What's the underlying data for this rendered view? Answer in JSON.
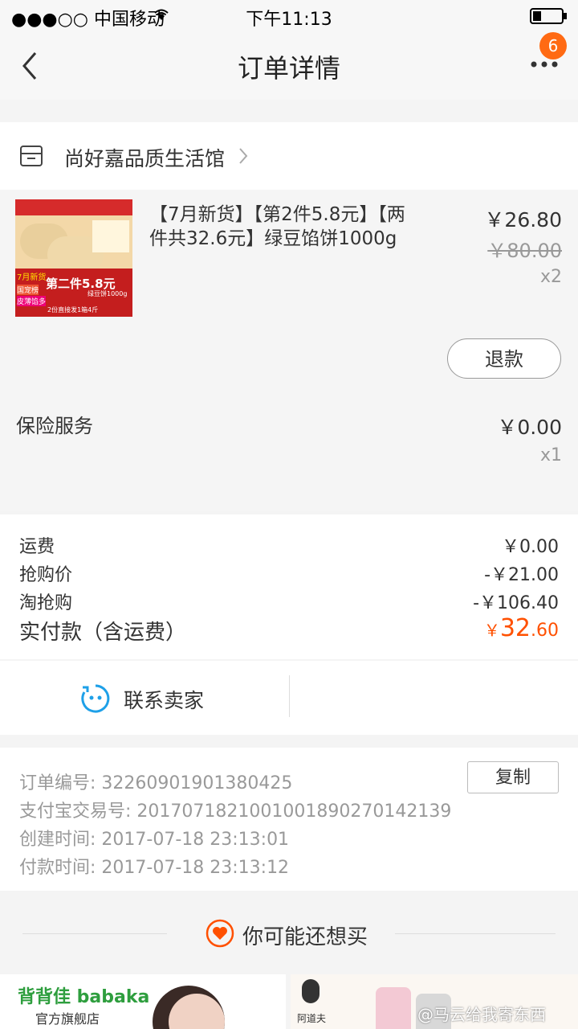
{
  "status_bar": {
    "carrier": "●●●○○ 中国移动",
    "time": "下午11:13"
  },
  "nav": {
    "title": "订单详情",
    "badge_count": "6"
  },
  "shop": {
    "name": "尚好嘉品质生活馆"
  },
  "product": {
    "title_line1": "【7月新货】【第2件5.8元】【两",
    "title_line2": "件共32.6元】绿豆馅饼1000g",
    "price": "￥26.80",
    "original_price": "￥80.00",
    "quantity": "x2",
    "image": {
      "banner_top": "7月新货",
      "banner_main": "第二件5.8元",
      "tag_left_1": "国宠榜",
      "tag_left_2": "皮薄馅多",
      "tag_right": "绿豆饼1000g",
      "footer": "2份直接发1箱4斤"
    },
    "refund_label": "退款"
  },
  "insurance": {
    "label": "保险服务",
    "price": "￥0.00",
    "quantity": "x1"
  },
  "charges": [
    {
      "label": "运费",
      "value": "￥0.00"
    },
    {
      "label": "抢购价",
      "value": "-￥21.00"
    },
    {
      "label": "淘抢购",
      "value": "-￥106.40"
    }
  ],
  "total": {
    "label": "实付款（含运费）",
    "currency": "￥",
    "integer": "32",
    "decimal": ".60"
  },
  "contact": {
    "label": "联系卖家"
  },
  "order_info": {
    "order_no": "订单编号:   3226090190138042​5",
    "alipay_no": "支付宝交易号:   2017071821001001890270142139",
    "created": "创建时间:   2017-07-18 23:13:01",
    "paid": "付款时间:   2017-07-18 23:13:12",
    "copy_label": "复制"
  },
  "recommend": {
    "title": "你可能还想买",
    "card1_brand": "背背佳 babaka",
    "card1_sub": "官方旗舰店",
    "card2_brand": "阿道夫"
  },
  "watermark": "@马云给我寄东西"
}
